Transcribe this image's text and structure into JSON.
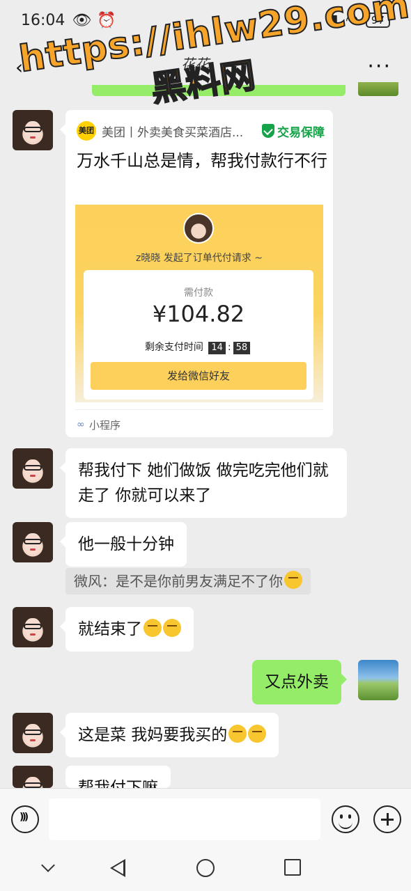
{
  "status_bar": {
    "time": "16:04",
    "battery": "97"
  },
  "header": {
    "title": "花花"
  },
  "watermark": {
    "line1": "https://ihlw29.com",
    "line2": "黑料网"
  },
  "card": {
    "logo_text": "美团",
    "source": "美团丨外卖美食买菜酒店...",
    "guarantee": "交易保障",
    "title": "万水千山总是情，帮我付款行不行",
    "requester": "z晓晓 发起了订单代付请求 ~",
    "amount_label": "需付款",
    "amount": "¥104.82",
    "timer_label": "剩余支付时间",
    "timer_minutes": "14",
    "timer_sep": ":",
    "timer_seconds": "58",
    "send_button": "发给微信好友",
    "footer": "小程序"
  },
  "messages": [
    {
      "side": "left",
      "text": "帮我付下 她们做饭 做完吃完他们就走了 你就可以来了"
    },
    {
      "side": "left",
      "text": "他一般十分钟"
    },
    {
      "side": "quote",
      "text": "微风：是不是你前男友满足不了你"
    },
    {
      "side": "left",
      "text": "就结束了"
    },
    {
      "side": "right",
      "text": "又点外卖"
    },
    {
      "side": "left",
      "text": "这是菜 我妈要我买的"
    },
    {
      "side": "left",
      "text": "帮我付下嘛"
    }
  ]
}
